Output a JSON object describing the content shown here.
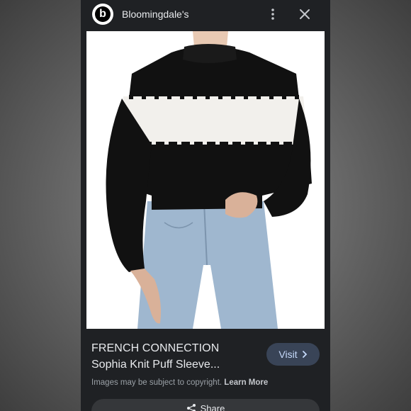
{
  "header": {
    "logo_letter": "b",
    "site_name": "Bloomingdale's",
    "more_icon": "more-vert-icon",
    "close_icon": "close-icon"
  },
  "product": {
    "brand": "FRENCH CONNECTION",
    "name": "Sophia Knit Puff Sleeve..."
  },
  "visit": {
    "label": "Visit",
    "icon": "chevron-right-icon"
  },
  "footer": {
    "copyright": "Images may be subject to copyright.",
    "learn_more": "Learn More"
  },
  "share": {
    "label": "Share",
    "icon": "share-icon"
  },
  "colors": {
    "panel_bg": "#1f2124",
    "visit_bg": "#394457",
    "visit_text": "#c6dafc",
    "text_primary": "#e8eaed",
    "text_secondary": "#9aa0a6"
  }
}
